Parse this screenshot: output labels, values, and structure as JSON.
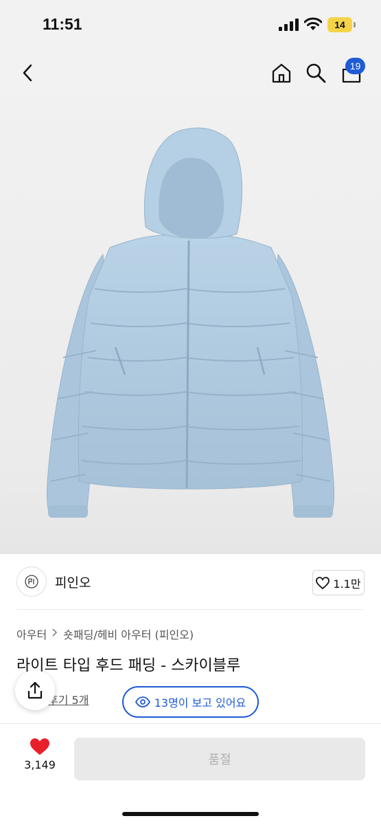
{
  "status_bar": {
    "time": "11:51",
    "battery": "14",
    "battery_color": "#f5d349"
  },
  "nav": {
    "back_icon": "chevron-left-icon",
    "home_icon": "home-icon",
    "search_icon": "search-icon",
    "cart_icon": "shopping-bag-icon",
    "cart_badge": "19",
    "accent_color": "#1f5bd6"
  },
  "product": {
    "image_description_icon": "jacket-image",
    "brand_name": "피인오",
    "brand_likes": "1.1만",
    "breadcrumb": [
      "아우터",
      "숏패딩/헤비 아우터 (피인오)"
    ],
    "title": "라이트 타입 후드 패딩 - 스카이블루",
    "review_link": "후기 5개",
    "viewers": "13명이 보고 있어요"
  },
  "bottom_bar": {
    "wishlist_count": "3,149",
    "heart_color": "#e8202a",
    "soldout_label": "품절"
  }
}
